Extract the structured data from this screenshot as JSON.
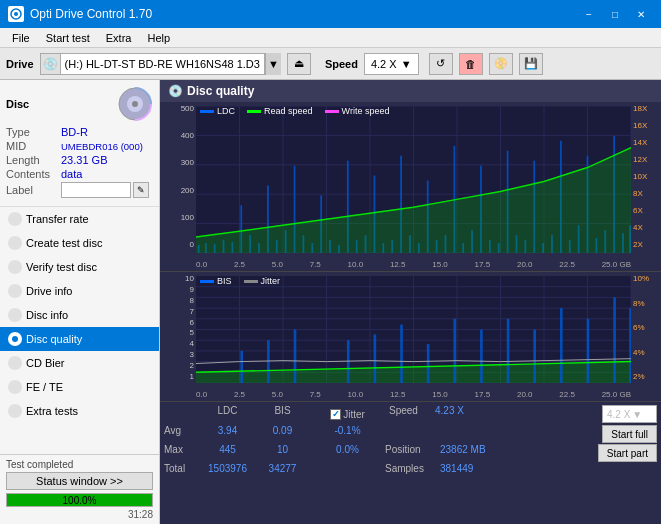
{
  "app": {
    "title": "Opti Drive Control 1.70",
    "icon": "disc-icon"
  },
  "titlebar": {
    "minimize_label": "−",
    "maximize_label": "□",
    "close_label": "✕"
  },
  "menubar": {
    "items": [
      "File",
      "Start test",
      "Extra",
      "Help"
    ]
  },
  "drivebar": {
    "drive_label": "Drive",
    "drive_icon": "💿",
    "drive_value": "(H:)  HL-DT-ST BD-RE  WH16NS48 1.D3",
    "speed_label": "Speed",
    "speed_value": "4.2 X"
  },
  "disc": {
    "title": "Disc",
    "type_label": "Type",
    "type_value": "BD-R",
    "mid_label": "MID",
    "mid_value": "UMEBDR016 (000)",
    "length_label": "Length",
    "length_value": "23.31 GB",
    "contents_label": "Contents",
    "contents_value": "data",
    "label_label": "Label",
    "label_value": ""
  },
  "nav": {
    "items": [
      {
        "id": "transfer-rate",
        "label": "Transfer rate",
        "active": false
      },
      {
        "id": "create-test-disc",
        "label": "Create test disc",
        "active": false
      },
      {
        "id": "verify-test-disc",
        "label": "Verify test disc",
        "active": false
      },
      {
        "id": "drive-info",
        "label": "Drive info",
        "active": false
      },
      {
        "id": "disc-info",
        "label": "Disc info",
        "active": false
      },
      {
        "id": "disc-quality",
        "label": "Disc quality",
        "active": true
      },
      {
        "id": "cd-bier",
        "label": "CD Bier",
        "active": false
      },
      {
        "id": "fe-te",
        "label": "FE / TE",
        "active": false
      },
      {
        "id": "extra-tests",
        "label": "Extra tests",
        "active": false
      }
    ]
  },
  "status": {
    "window_btn": "Status window >>",
    "progress": 100,
    "progress_label": "100.0%",
    "status_text": "31:28",
    "completed_text": "Test completed"
  },
  "chart": {
    "title": "Disc quality",
    "upper_legend": [
      {
        "color": "#0088ff",
        "label": "LDC"
      },
      {
        "color": "#00ff00",
        "label": "Read speed"
      },
      {
        "color": "#ff00ff",
        "label": "Write speed"
      }
    ],
    "lower_legend": [
      {
        "color": "#0088ff",
        "label": "BIS"
      },
      {
        "color": "#888888",
        "label": "Jitter"
      }
    ],
    "upper_y_labels": [
      "500",
      "400",
      "300",
      "200",
      "100",
      "0"
    ],
    "upper_y_right_labels": [
      "18X",
      "16X",
      "14X",
      "12X",
      "10X",
      "8X",
      "6X",
      "4X",
      "2X"
    ],
    "lower_y_labels": [
      "10",
      "9",
      "8",
      "7",
      "6",
      "5",
      "4",
      "3",
      "2",
      "1"
    ],
    "lower_y_right_labels": [
      "10%",
      "8%",
      "6%",
      "4%",
      "2%"
    ],
    "x_labels": [
      "0.0",
      "2.5",
      "5.0",
      "7.5",
      "10.0",
      "12.5",
      "15.0",
      "17.5",
      "20.0",
      "22.5",
      "25.0 GB"
    ]
  },
  "stats": {
    "col_ldc": "LDC",
    "col_bis": "BIS",
    "col_jitter": "Jitter",
    "col_speed": "Speed",
    "jitter_checked": true,
    "rows": [
      {
        "label": "Avg",
        "ldc": "3.94",
        "bis": "0.09",
        "jitter": "-0.1%",
        "speed_label": "Speed",
        "speed_val": "4.23 X"
      },
      {
        "label": "Max",
        "ldc": "445",
        "bis": "10",
        "jitter": "0.0%",
        "pos_label": "Position",
        "pos_val": "23862 MB"
      },
      {
        "label": "Total",
        "ldc": "1503976",
        "bis": "34277",
        "jitter": "",
        "samples_label": "Samples",
        "samples_val": "381449"
      }
    ],
    "speed_dropdown": "4.2 X",
    "start_full_label": "Start full",
    "start_part_label": "Start part"
  }
}
